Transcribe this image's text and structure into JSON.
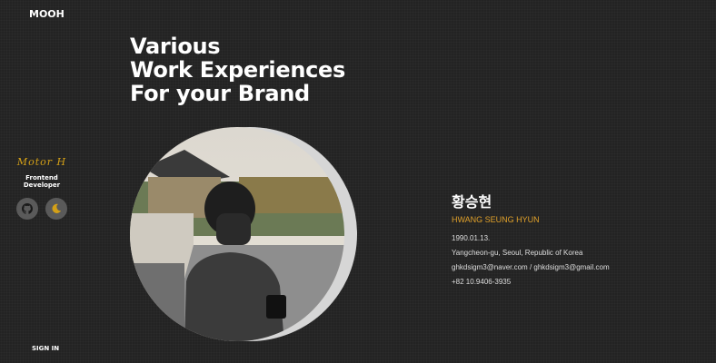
{
  "logo": "MOOH",
  "headline": [
    "Various",
    "Work Experiences",
    "For your Brand"
  ],
  "sidebar": {
    "signature": "Motor H",
    "role": "Frontend Developer",
    "icons": [
      "github-icon",
      "moon-icon"
    ]
  },
  "signin": "SIGN IN",
  "profile": {
    "name_kr": "황승현",
    "name_en": "HWANG SEUNG HYUN",
    "birth": "1990.01.13.",
    "address": "Yangcheon-gu, Seoul, Republic of Korea",
    "email": "ghkdsigm3@naver.com / ghkdsigm3@gmail.com",
    "phone": "+82 10.9406-3935"
  },
  "colors": {
    "accent": "#e0a12a",
    "background": "#232323"
  }
}
